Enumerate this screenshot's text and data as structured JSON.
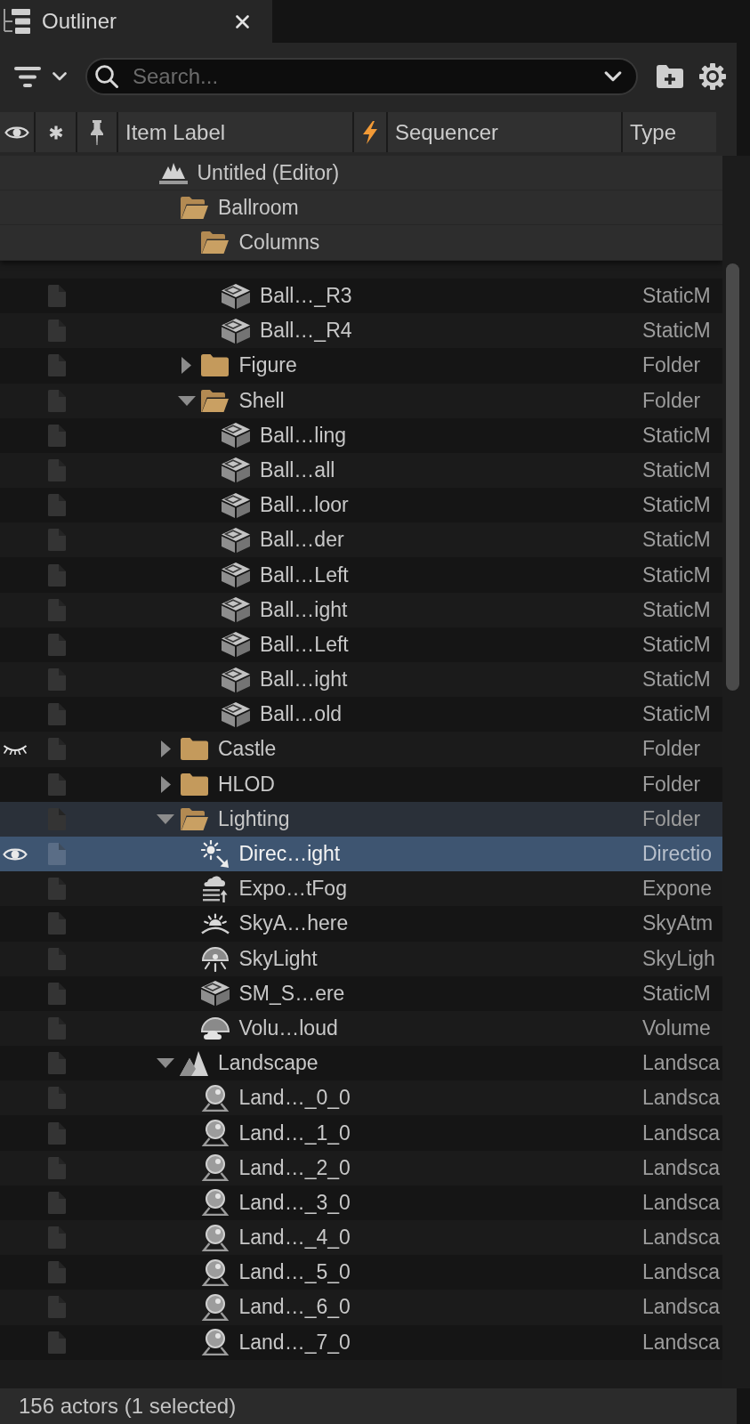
{
  "tab": {
    "title": "Outliner"
  },
  "toolbar": {
    "search": {
      "placeholder": "Search..."
    }
  },
  "columns": [
    {
      "kind": "visibility"
    },
    {
      "kind": "unsaved"
    },
    {
      "kind": "pin"
    },
    {
      "kind": "label",
      "label": "Item Label"
    },
    {
      "kind": "sequencer"
    },
    {
      "kind": "label",
      "label": "Sequencer"
    },
    {
      "kind": "label",
      "label": "Type"
    }
  ],
  "tree": [
    {
      "label": "Untitled (Editor)",
      "kind": "world",
      "pinned": true,
      "selected": false,
      "hovered": false,
      "hidden": false,
      "children": [
        {
          "label": "Ballroom",
          "kind": "folder",
          "expanded": true,
          "pinned": true,
          "selected": false,
          "hovered": false,
          "hidden": false,
          "children": [
            {
              "label": "Columns",
              "kind": "folder",
              "expanded": true,
              "pinned": true,
              "selected": false,
              "hovered": false,
              "hidden": false,
              "children": [
                {
                  "label": "Ball…_R3",
                  "type": "StaticM",
                  "kind": "static_mesh",
                  "pinned": false,
                  "selected": false,
                  "hovered": false,
                  "hidden": false
                },
                {
                  "label": "Ball…_R4",
                  "type": "StaticM",
                  "kind": "static_mesh",
                  "pinned": false,
                  "selected": false,
                  "hovered": false,
                  "hidden": false
                }
              ]
            },
            {
              "label": "Figure",
              "type": "Folder",
              "kind": "folder",
              "expanded": false,
              "pinned": false,
              "selected": false,
              "hovered": false,
              "hidden": false
            },
            {
              "label": "Shell",
              "type": "Folder",
              "kind": "folder",
              "expanded": true,
              "pinned": false,
              "selected": false,
              "hovered": false,
              "hidden": false,
              "children": [
                {
                  "label": "Ball…ling",
                  "type": "StaticM",
                  "kind": "static_mesh",
                  "pinned": false,
                  "selected": false,
                  "hovered": false,
                  "hidden": false
                },
                {
                  "label": "Ball…all",
                  "type": "StaticM",
                  "kind": "static_mesh",
                  "pinned": false,
                  "selected": false,
                  "hovered": false,
                  "hidden": false
                },
                {
                  "label": "Ball…loor",
                  "type": "StaticM",
                  "kind": "static_mesh",
                  "pinned": false,
                  "selected": false,
                  "hovered": false,
                  "hidden": false
                },
                {
                  "label": "Ball…der",
                  "type": "StaticM",
                  "kind": "static_mesh",
                  "pinned": false,
                  "selected": false,
                  "hovered": false,
                  "hidden": false
                },
                {
                  "label": "Ball…Left",
                  "type": "StaticM",
                  "kind": "static_mesh",
                  "pinned": false,
                  "selected": false,
                  "hovered": false,
                  "hidden": false
                },
                {
                  "label": "Ball…ight",
                  "type": "StaticM",
                  "kind": "static_mesh",
                  "pinned": false,
                  "selected": false,
                  "hovered": false,
                  "hidden": false
                },
                {
                  "label": "Ball…Left",
                  "type": "StaticM",
                  "kind": "static_mesh",
                  "pinned": false,
                  "selected": false,
                  "hovered": false,
                  "hidden": false
                },
                {
                  "label": "Ball…ight",
                  "type": "StaticM",
                  "kind": "static_mesh",
                  "pinned": false,
                  "selected": false,
                  "hovered": false,
                  "hidden": false
                },
                {
                  "label": "Ball…old",
                  "type": "StaticM",
                  "kind": "static_mesh",
                  "pinned": false,
                  "selected": false,
                  "hovered": false,
                  "hidden": false
                }
              ]
            }
          ]
        },
        {
          "label": "Castle",
          "type": "Folder",
          "kind": "folder",
          "expanded": false,
          "pinned": false,
          "selected": false,
          "hovered": false,
          "hidden": true
        },
        {
          "label": "HLOD",
          "type": "Folder",
          "kind": "folder",
          "expanded": false,
          "pinned": false,
          "selected": false,
          "hovered": false,
          "hidden": false
        },
        {
          "label": "Lighting",
          "type": "Folder",
          "kind": "folder",
          "expanded": true,
          "pinned": false,
          "selected": false,
          "hovered": true,
          "hidden": false,
          "children": [
            {
              "label": "Direc…ight",
              "type": "Directio",
              "kind": "directional_light",
              "pinned": false,
              "selected": true,
              "hovered": false,
              "hidden": false
            },
            {
              "label": "Expo…tFog",
              "type": "Expone",
              "kind": "fog",
              "pinned": false,
              "selected": false,
              "hovered": false,
              "hidden": false
            },
            {
              "label": "SkyA…here",
              "type": "SkyAtm",
              "kind": "sky_atmosphere",
              "pinned": false,
              "selected": false,
              "hovered": false,
              "hidden": false
            },
            {
              "label": "SkyLight",
              "type": "SkyLigh",
              "kind": "sky_light",
              "pinned": false,
              "selected": false,
              "hovered": false,
              "hidden": false
            },
            {
              "label": "SM_S…ere",
              "type": "StaticM",
              "kind": "static_mesh",
              "pinned": false,
              "selected": false,
              "hovered": false,
              "hidden": false
            },
            {
              "label": "Volu…loud",
              "type": "Volume",
              "kind": "volumetric_cloud",
              "pinned": false,
              "selected": false,
              "hovered": false,
              "hidden": false
            }
          ]
        },
        {
          "label": "Landscape",
          "type": "Landsca",
          "kind": "landscape",
          "expanded": true,
          "pinned": false,
          "selected": false,
          "hovered": false,
          "hidden": false,
          "children": [
            {
              "label": "Land…_0_0",
              "type": "Landsca",
              "kind": "landscape_proxy",
              "pinned": false,
              "selected": false,
              "hovered": false,
              "hidden": false
            },
            {
              "label": "Land…_1_0",
              "type": "Landsca",
              "kind": "landscape_proxy",
              "pinned": false,
              "selected": false,
              "hovered": false,
              "hidden": false
            },
            {
              "label": "Land…_2_0",
              "type": "Landsca",
              "kind": "landscape_proxy",
              "pinned": false,
              "selected": false,
              "hovered": false,
              "hidden": false
            },
            {
              "label": "Land…_3_0",
              "type": "Landsca",
              "kind": "landscape_proxy",
              "pinned": false,
              "selected": false,
              "hovered": false,
              "hidden": false
            },
            {
              "label": "Land…_4_0",
              "type": "Landsca",
              "kind": "landscape_proxy",
              "pinned": false,
              "selected": false,
              "hovered": false,
              "hidden": false
            },
            {
              "label": "Land…_5_0",
              "type": "Landsca",
              "kind": "landscape_proxy",
              "pinned": false,
              "selected": false,
              "hovered": false,
              "hidden": false
            },
            {
              "label": "Land…_6_0",
              "type": "Landsca",
              "kind": "landscape_proxy",
              "pinned": false,
              "selected": false,
              "hovered": false,
              "hidden": false
            },
            {
              "label": "Land…_7_0",
              "type": "Landsca",
              "kind": "landscape_proxy",
              "pinned": false,
              "selected": false,
              "hovered": false,
              "hidden": false
            }
          ]
        }
      ]
    }
  ],
  "status_bar": {
    "text": "156 actors (1 selected)"
  }
}
